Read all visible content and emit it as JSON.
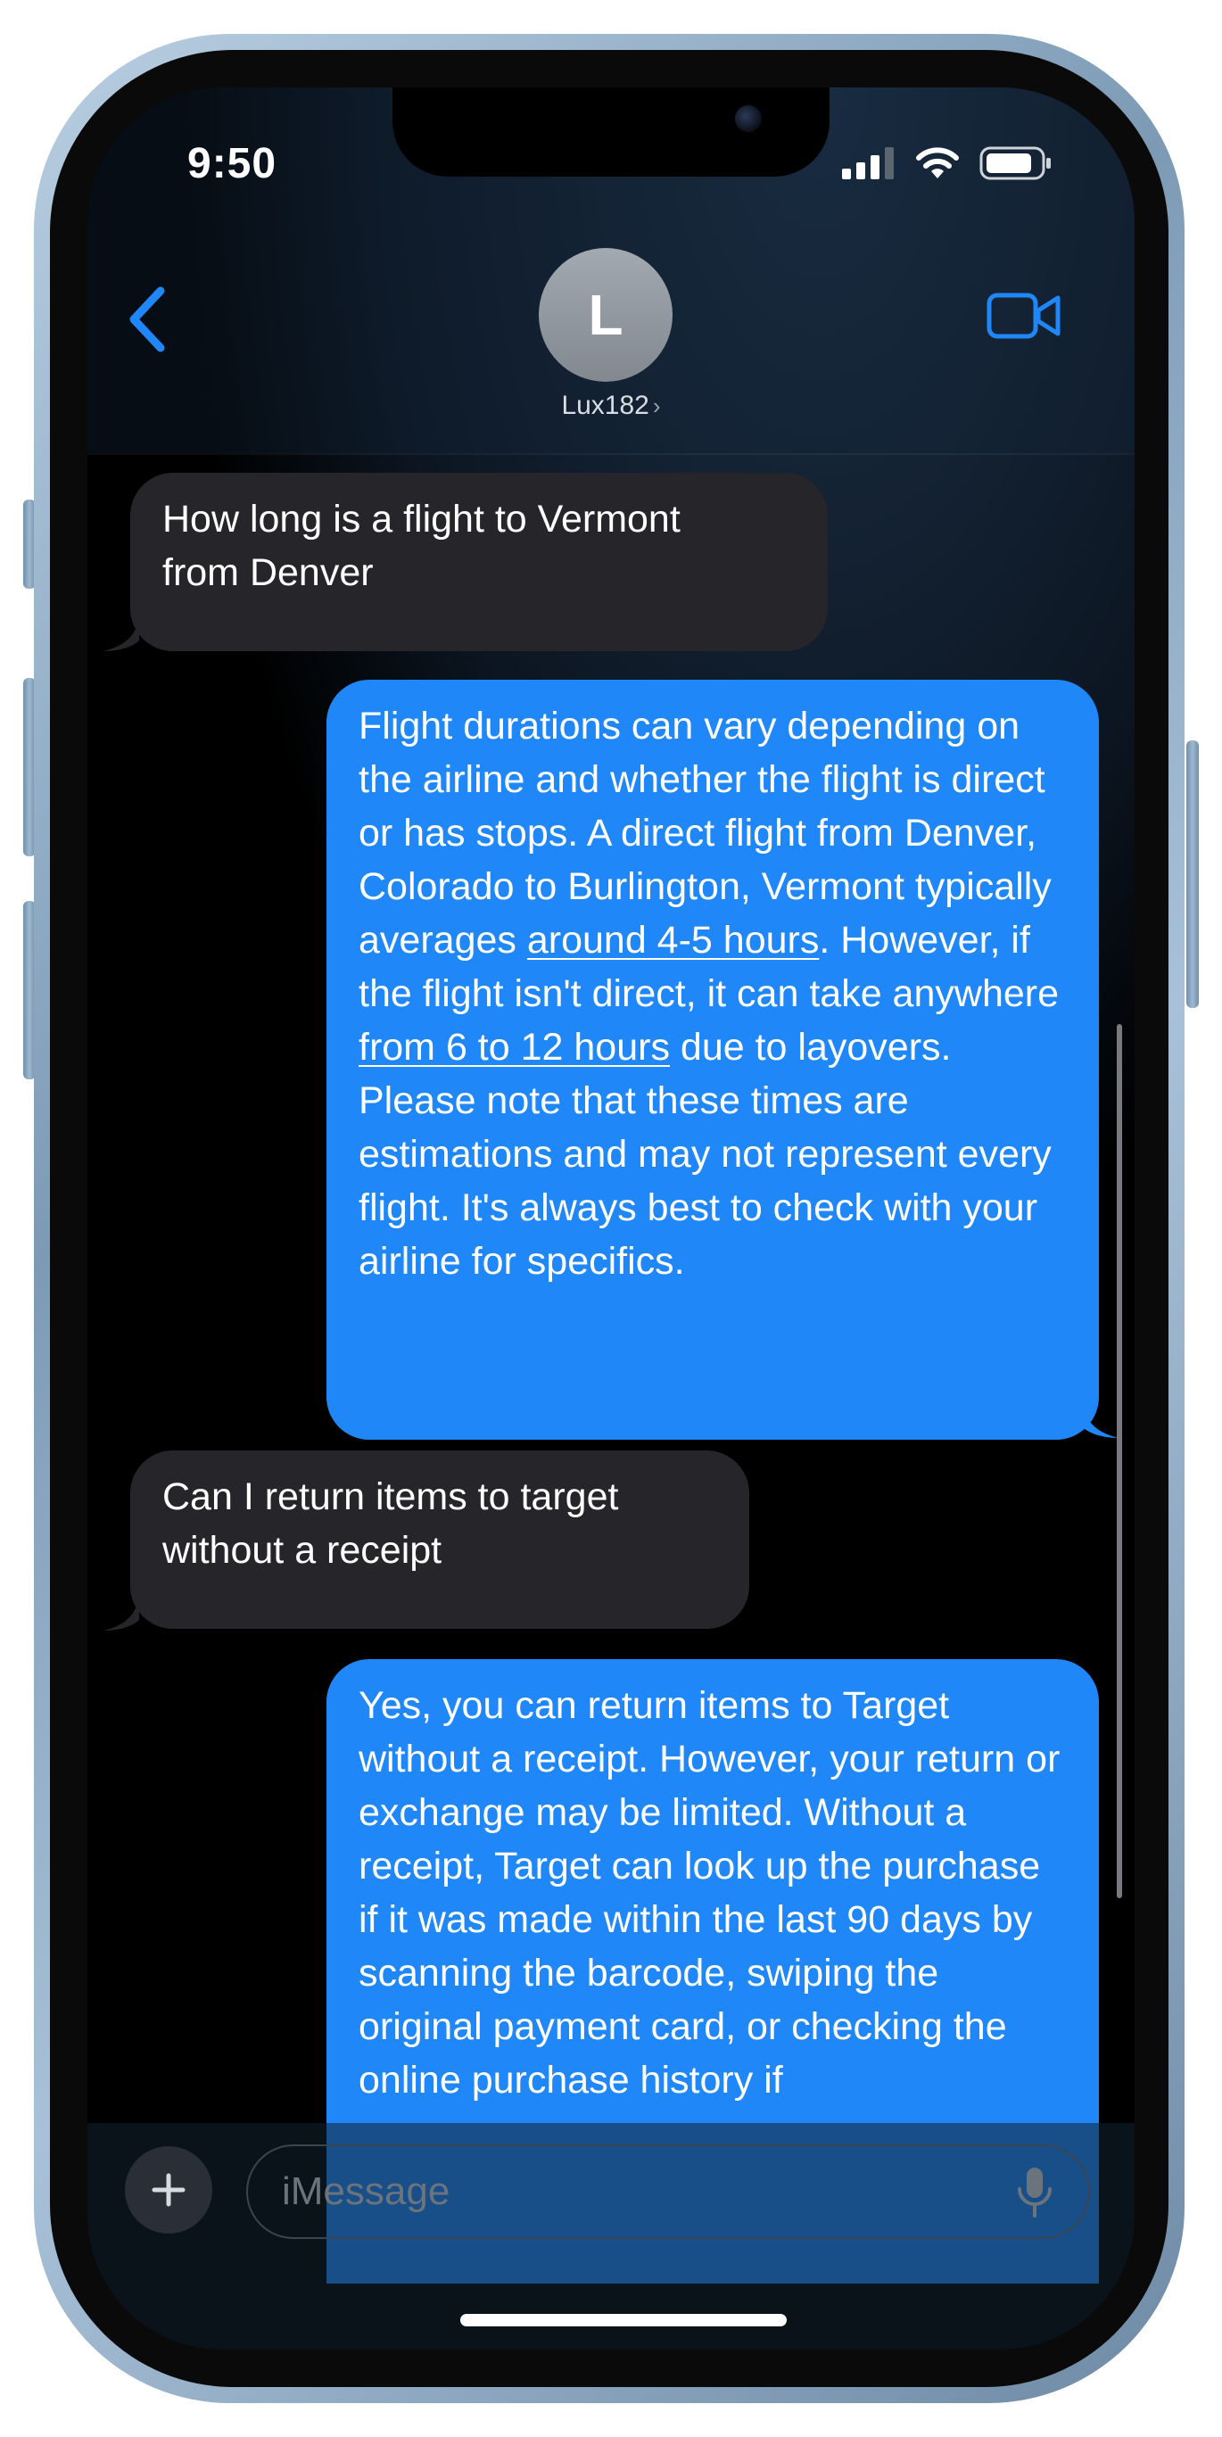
{
  "status_bar": {
    "time": "9:50"
  },
  "header": {
    "back_label": "‹",
    "avatar_initial": "L",
    "contact_name": "Lux182",
    "contact_chevron": "›"
  },
  "messages": [
    {
      "direction": "incoming",
      "lines": [
        "How long is a flight to Vermont",
        "from Denver"
      ]
    },
    {
      "direction": "outgoing",
      "segments": [
        {
          "text": "Flight durations can vary depending on the airline and whether the flight is direct or has stops. A direct flight from Denver, Colorado to Burlington, Vermont typically averages ",
          "underline": false
        },
        {
          "text": "around 4-5 hours",
          "underline": true
        },
        {
          "text": ". However, if the flight isn't direct, it can take anywhere ",
          "underline": false
        },
        {
          "text": "from 6 to 12 hours",
          "underline": true
        },
        {
          "text": " due to layovers. Please note that these times are estimations and may not represent every flight. It's always best to check with your airline for specifics.",
          "underline": false
        }
      ]
    },
    {
      "direction": "incoming",
      "lines": [
        "Can I return items to target",
        "without a receipt"
      ]
    },
    {
      "direction": "outgoing",
      "text": "Yes, you can return items to Target without a receipt. However, your return or exchange may be limited. Without a receipt, Target can look up the purchase if it was made within the last 90 days by scanning the barcode, swiping the original payment card, or checking the online purchase history if"
    }
  ],
  "compose": {
    "placeholder": "iMessage"
  },
  "icons": {
    "back": "chevron-left-icon",
    "video": "video-camera-icon",
    "plus": "plus-icon",
    "mic": "microphone-icon",
    "signal": "cellular-signal-icon",
    "wifi": "wifi-icon",
    "battery": "battery-icon"
  },
  "colors": {
    "accent": "#1f87f7",
    "incoming_bubble": "#26262a",
    "outgoing_bubble": "#1f87f7"
  }
}
